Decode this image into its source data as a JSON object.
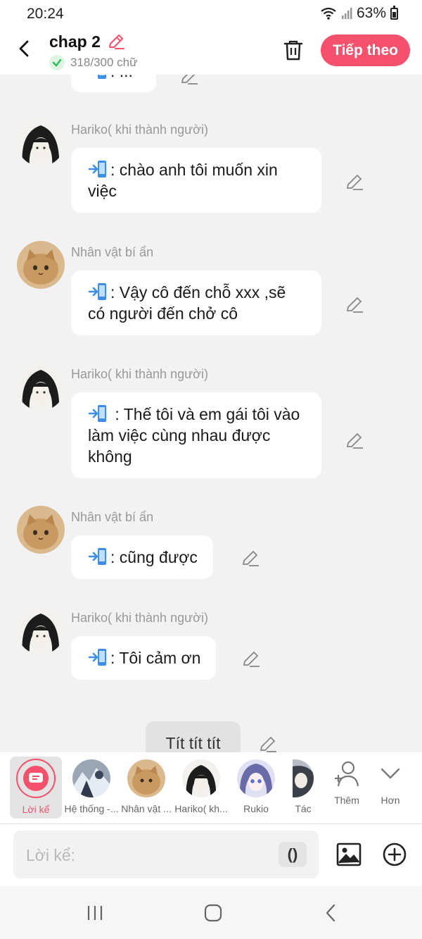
{
  "status": {
    "time": "20:24",
    "battery": "63%"
  },
  "header": {
    "title": "chap 2",
    "word_count": "318/300 chữ",
    "next_label": "Tiếp theo"
  },
  "messages": [
    {
      "name": "",
      "text": ": ..."
    },
    {
      "name": "Hariko( khi thành người)",
      "text": ": chào anh tôi muốn xin việc"
    },
    {
      "name": "Nhân vật bí ẩn",
      "text": ": Vậy cô đến chỗ xxx ,sẽ có người đến chở cô"
    },
    {
      "name": "Hariko( khi thành người)",
      "text": " : Thế tôi và em gái tôi vào làm việc cùng nhau được không"
    },
    {
      "name": "Nhân vật bí ẩn",
      "text": ": cũng được"
    },
    {
      "name": "Hariko( khi thành người)",
      "text": ": Tôi cảm ơn"
    }
  ],
  "narration": {
    "text": "Tít tít tít"
  },
  "characters": {
    "narrator": "Lời kể",
    "items": [
      {
        "label": "Hệ thống -..."
      },
      {
        "label": "Nhân vật ..."
      },
      {
        "label": "Hariko( kh..."
      },
      {
        "label": "Rukio"
      },
      {
        "label": "Tác"
      }
    ],
    "add_label": "Thêm",
    "more_label": "Hơn"
  },
  "input": {
    "placeholder": "Lời kể:",
    "paren_label": "()"
  },
  "colors": {
    "accent": "#f5506c",
    "background": "#f2f2f2",
    "bubble": "#ffffff"
  },
  "icons": [
    "back-arrow-icon",
    "pencil-icon",
    "check-icon",
    "trash-icon",
    "phone-transfer-icon",
    "image-icon",
    "plus-circle-icon",
    "add-person-icon",
    "chevron-down-icon"
  ]
}
